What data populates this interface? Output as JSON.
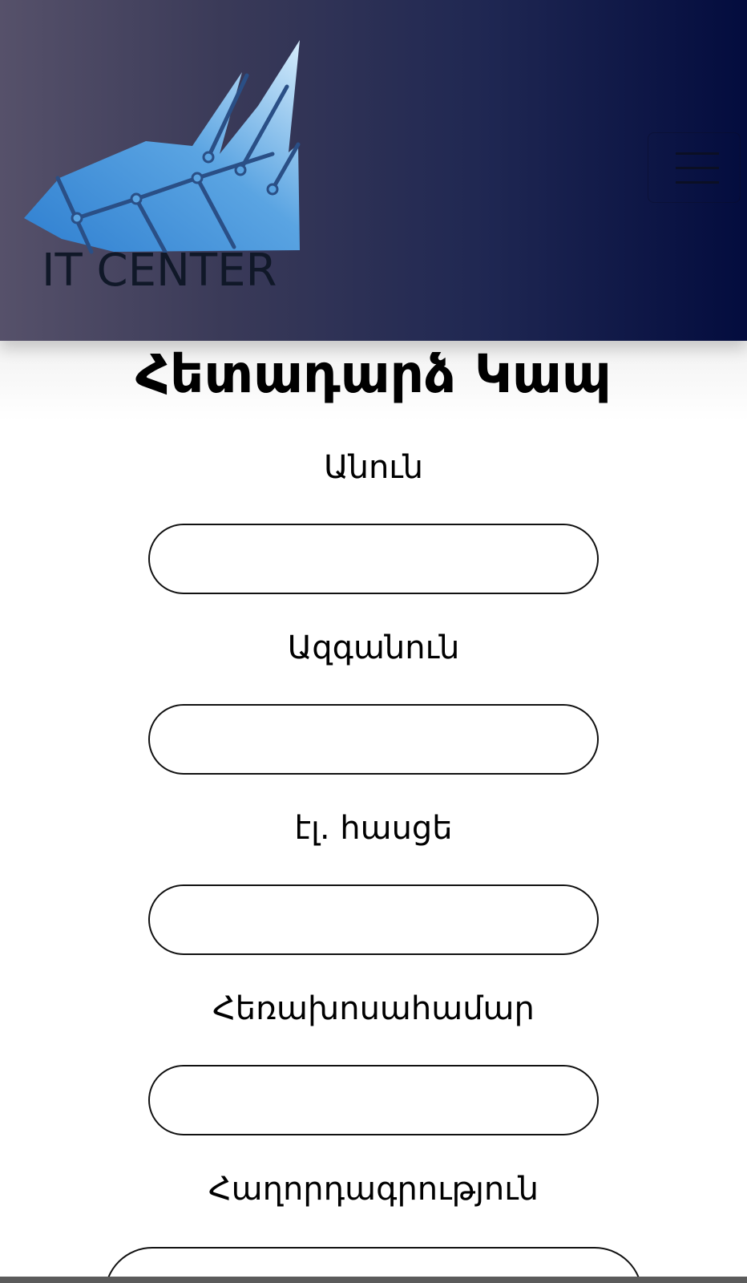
{
  "header": {
    "logo_text": "IT CENTER",
    "menu_icon": "hamburger-menu-icon",
    "gradient_start": "#56516a",
    "gradient_end": "#030c3e"
  },
  "page": {
    "title": "Հետադարձ Կապ"
  },
  "form": {
    "fields": [
      {
        "label": "Անուն",
        "value": "",
        "placeholder": ""
      },
      {
        "label": "Ազգանուն",
        "value": "",
        "placeholder": ""
      },
      {
        "label": "էլ. հասցե",
        "value": "",
        "placeholder": ""
      },
      {
        "label": "Հեռախոսահամար",
        "value": "",
        "placeholder": ""
      },
      {
        "label": "Հաղորդագրություն",
        "value": "",
        "placeholder": ""
      }
    ]
  }
}
